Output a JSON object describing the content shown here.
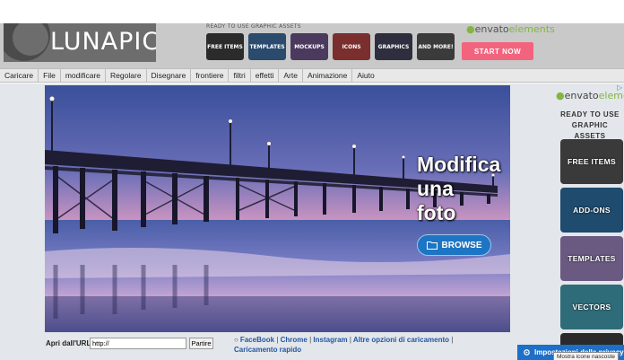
{
  "logo": {
    "text": "LUNAPIC"
  },
  "top_ad": {
    "tagline": "READY TO USE GRAPHIC ASSETS",
    "buttons": [
      {
        "label": "FREE ITEMS",
        "color": "#2b2b2b"
      },
      {
        "label": "TEMPLATES",
        "color": "#2a4a6e"
      },
      {
        "label": "MOCKUPS",
        "color": "#4c3a5e"
      },
      {
        "label": "ICONS",
        "color": "#7a2e2e"
      },
      {
        "label": "GRAPHICS",
        "color": "#2e2e3e"
      },
      {
        "label": "AND MORE!",
        "color": "#3b3b3b"
      }
    ],
    "brand_prefix": "envato",
    "brand_suffix": "elements",
    "cta": "START NOW"
  },
  "menu": [
    "Caricare",
    "File",
    "modificare",
    "Regolare",
    "Disegnare",
    "frontiere",
    "filtri",
    "effetti",
    "Arte",
    "Animazione",
    "Aiuto"
  ],
  "hero": {
    "headline_1": "Modifica",
    "headline_2": "una",
    "headline_3": "foto",
    "browse_label": "BROWSE",
    "browse_icon": "folder-icon"
  },
  "url_row": {
    "label": "Apri dall'URL:",
    "input_value": "http://",
    "go_label": "Partire"
  },
  "upload_links": [
    "FaceBook",
    "Chrome",
    "Instagram",
    "Altre opzioni di caricamento",
    "Caricamento rapido"
  ],
  "right_ad": {
    "adchoices": "▷",
    "brand_prefix": "envato",
    "brand_suffix": "elements",
    "tagline": "READY TO USE GRAPHIC ASSETS",
    "buttons": [
      {
        "label": "FREE ITEMS",
        "color": "#3a3a3a"
      },
      {
        "label": "ADD-ONS",
        "color": "#1e4b6e"
      },
      {
        "label": "TEMPLATES",
        "color": "#6a5a82"
      },
      {
        "label": "VECTORS",
        "color": "#2f6c7a"
      },
      {
        "label": "",
        "color": "#2a2a2a"
      }
    ]
  },
  "cookie_bar": {
    "label": "Impostazioni della privacy",
    "icon": "gear-icon"
  },
  "tooltip": "Mostra icone nascoste",
  "colors": {
    "menu_bg": "#e8e8e8",
    "header_bg": "#c9c9c9",
    "accent_blue": "#1d75c4",
    "cta_pink": "#f2647e"
  }
}
